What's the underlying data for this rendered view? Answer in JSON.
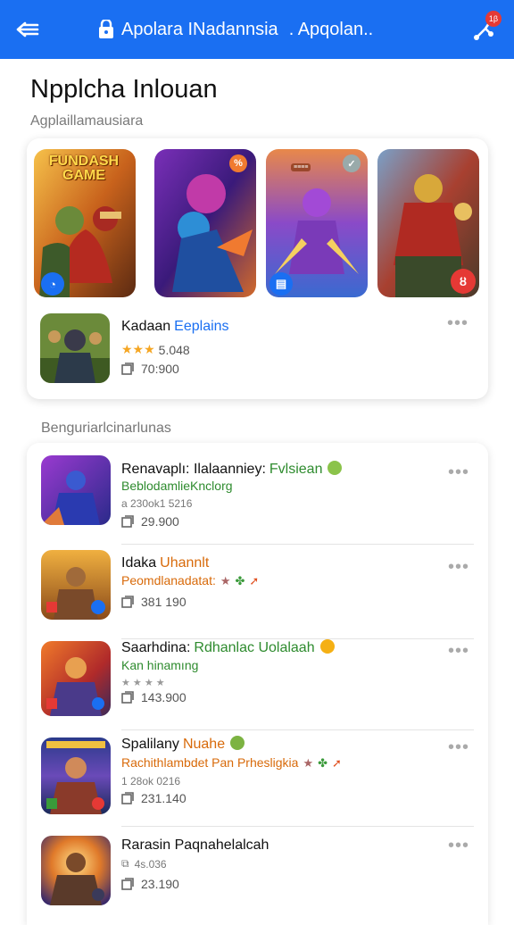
{
  "header": {
    "title": "Apolara INadannsia",
    "subtitle": ". Apqolan..",
    "notification_count": "1β"
  },
  "page": {
    "title": "Npplcha Inlouan",
    "subtitle": "Agplaillamausiara"
  },
  "featured": {
    "tiles": [
      {
        "caption": "FUNDASH GAME",
        "chip": "≡≡≡"
      },
      {
        "caption": "",
        "chip": ""
      },
      {
        "caption": "",
        "chip": "≡≡≡≡"
      },
      {
        "caption": "",
        "chip": ""
      }
    ],
    "app": {
      "name": "Kadaan",
      "name_accent": "Eeplains",
      "rating": "5.048",
      "downloads": "70:900"
    }
  },
  "section": {
    "label": "Benguriarlcinarlunas"
  },
  "list": [
    {
      "name": "Renavaplı: Ilalaanniey:",
      "name_accent": "Fvlsiean",
      "subtitle": "BeblodamlieKnclorg",
      "meta": "a 230ok1 5216",
      "downloads": "29.900",
      "accent_color": "#2e8b2e",
      "dot_color": "#8bc34a"
    },
    {
      "name": "Idaka",
      "name_accent": "Uhannlt",
      "subtitle": "Peomdlanadatat:",
      "meta": "",
      "downloads": "381 190",
      "accent_color": "#d86a0a",
      "dot_color": ""
    },
    {
      "name": "Saarhdina:",
      "name_accent": "Rdhanlac Uolalaah",
      "subtitle": "Kan hinamıng",
      "meta": "",
      "downloads": "143.900",
      "accent_color": "#2e8b2e",
      "dot_color": "#f5b014"
    },
    {
      "name": "Spalilany",
      "name_accent": "Nuahe",
      "subtitle": "Rachithlambdet Pan Prhesligkia",
      "meta": "1 28ok 0216",
      "downloads": "231.140",
      "accent_color": "#d86a0a",
      "dot_color": "#7cb342"
    },
    {
      "name": "Rarasin Paqnahelalcah",
      "name_accent": "",
      "subtitle": "",
      "meta": "4s.036",
      "downloads": "23.190",
      "accent_color": "#111111",
      "dot_color": ""
    }
  ],
  "colors": {
    "topbar": "#1a6ff2",
    "accent_blue": "#1a6ff2",
    "accent_green": "#2e8b2e",
    "accent_orange": "#d86a0a",
    "star": "#f5a623"
  }
}
